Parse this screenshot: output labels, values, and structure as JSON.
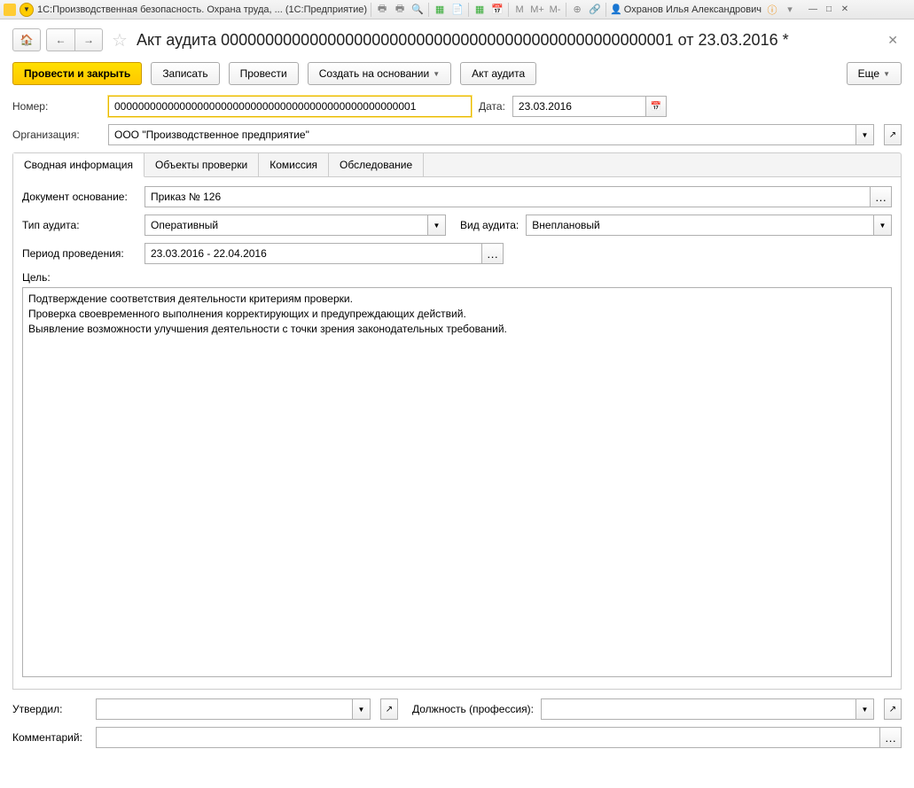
{
  "titlebar": {
    "app_title": "1С:Производственная безопасность. Охрана труда, ... (1С:Предприятие)",
    "user": "Охранов Илья Александрович"
  },
  "header": {
    "title": "Акт аудита 000000000000000000000000000000000000000000000000001 от 23.03.2016 *"
  },
  "toolbar": {
    "post_close": "Провести и закрыть",
    "save": "Записать",
    "post": "Провести",
    "create_based": "Создать на основании",
    "audit_act": "Акт аудита",
    "more": "Еще"
  },
  "form": {
    "number_label": "Номер:",
    "number_value": "000000000000000000000000000000000000000000000000001",
    "date_label": "Дата:",
    "date_value": "23.03.2016",
    "org_label": "Организация:",
    "org_value": "ООО \"Производственное предприятие\""
  },
  "tabs": {
    "summary": "Сводная информация",
    "objects": "Объекты проверки",
    "commission": "Комиссия",
    "survey": "Обследование"
  },
  "summary": {
    "basis_label": "Документ основание:",
    "basis_value": "Приказ № 126",
    "audit_type_label": "Тип аудита:",
    "audit_type_value": "Оперативный",
    "audit_kind_label": "Вид аудита:",
    "audit_kind_value": "Внеплановый",
    "period_label": "Период проведения:",
    "period_value": "23.03.2016 - 22.04.2016",
    "goal_label": "Цель:",
    "goal_value": "Подтверждение соответствия деятельности критериям проверки.\nПроверка своевременного выполнения корректирующих и предупреждающих действий.\nВыявление возможности улучшения деятельности с точки зрения законодательных требований."
  },
  "footer": {
    "approved_label": "Утвердил:",
    "approved_value": "",
    "position_label": "Должность (профессия):",
    "position_value": "",
    "comment_label": "Комментарий:",
    "comment_value": ""
  }
}
